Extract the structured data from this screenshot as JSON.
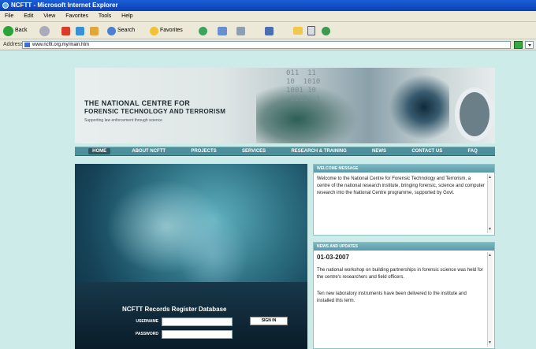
{
  "window": {
    "title": "NCFTT - Microsoft Internet Explorer"
  },
  "menu": [
    "File",
    "Edit",
    "View",
    "Favorites",
    "Tools",
    "Help"
  ],
  "toolbar": {
    "back": "Back",
    "search": "Search",
    "favorites": "Favorites"
  },
  "address": {
    "label": "Address",
    "url": "www.ncftt.org.my/main.htm"
  },
  "banner": {
    "title_line1": "THE NATIONAL CENTRE FOR",
    "title_line2": "FORENSIC TECHNOLOGY AND TERRORISM",
    "subtitle": "Supporting law enforcement through science",
    "digits": "011  11\n10  1010\n1001 10\n 0110  1"
  },
  "nav": {
    "items": [
      "HOME",
      "ABOUT NCFTT",
      "PROJECTS",
      "SERVICES",
      "RESEARCH & TRAINING",
      "NEWS",
      "CONTACT US",
      "FAQ"
    ]
  },
  "login": {
    "title": "NCFTT Records Register Database",
    "username_label": "USERNAME",
    "password_label": "PASSWORD",
    "button": "SIGN IN"
  },
  "welcome_panel": {
    "heading": "WELCOME MESSAGE",
    "text": "Welcome to the National Centre for Forensic Technology and Terrorism, a centre of the national research institute, bringing forensic, science and computer research into the National Centre programme, supported by Govt."
  },
  "news_panel": {
    "heading": "NEWS AND UPDATES",
    "date": "01-03-2007",
    "para1": "The national workshop on building partnerships in forensic science was held for the centre's researchers and field officers.",
    "para2": "Ten new laboratory instruments have been delivered to the institute and installed this term."
  },
  "colors": {
    "page_bg": "#cdebe8",
    "nav_bg": "#4d8f9b",
    "panel_head": "#5a9aa6"
  }
}
